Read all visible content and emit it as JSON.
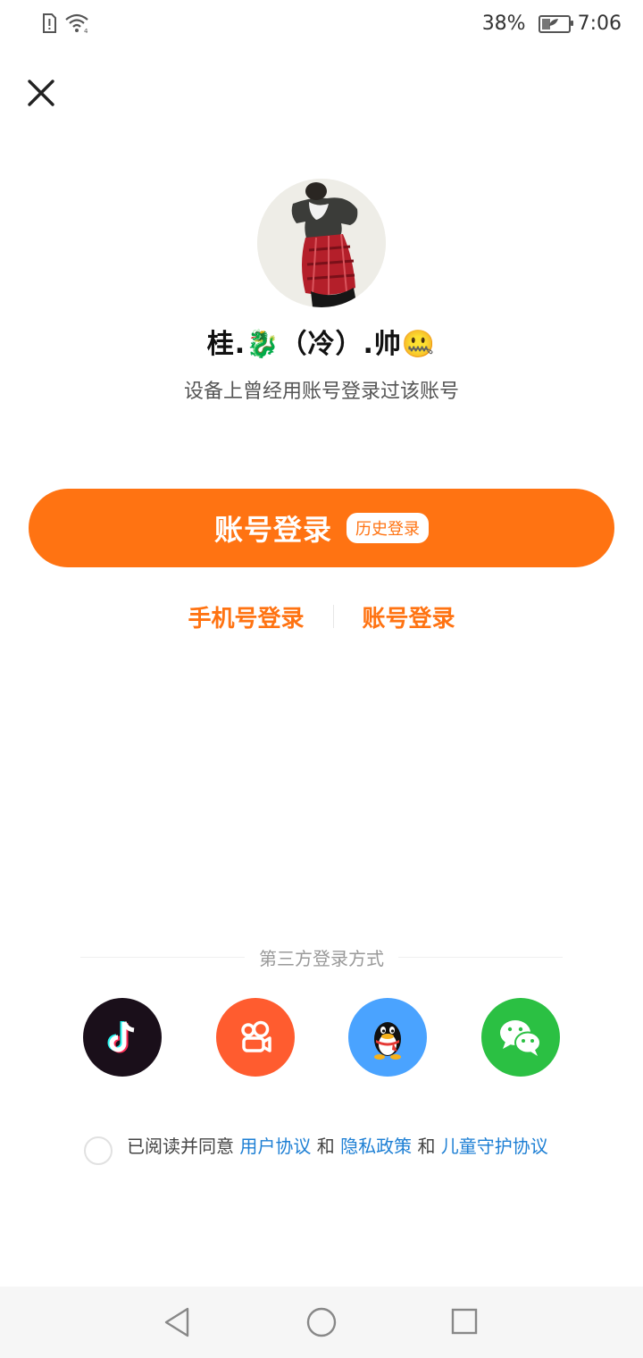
{
  "status_bar": {
    "battery_percent": "38%",
    "time": "7:06",
    "icons": [
      "sim-alert-icon",
      "wifi-icon",
      "battery-icon"
    ]
  },
  "header": {
    "close_icon": "close-icon"
  },
  "profile": {
    "nickname": "桂.🐉（冷）.帅🤐",
    "subtitle": "设备上曾经用账号登录过该账号"
  },
  "primary_button": {
    "label": "账号登录",
    "tag": "历史登录",
    "color": "#ff7312"
  },
  "alt_login": {
    "phone_label": "手机号登录",
    "account_label": "账号登录"
  },
  "third_party": {
    "title": "第三方登录方式",
    "providers": [
      {
        "icon": "douyin-icon",
        "color": "#1a0f1a"
      },
      {
        "icon": "kuaishou-icon",
        "color": "#ff5c2f"
      },
      {
        "icon": "qq-icon",
        "color": "#4aa3ff"
      },
      {
        "icon": "wechat-icon",
        "color": "#2bc043"
      }
    ]
  },
  "agreement": {
    "prefix": "已阅读并同意",
    "user_agreement": "用户协议",
    "and1": "和",
    "privacy_policy": "隐私政策",
    "and2": "和",
    "children_protection": "儿童守护协议"
  },
  "nav_bar": {
    "icons": [
      "back-icon",
      "home-icon",
      "recent-apps-icon"
    ]
  }
}
